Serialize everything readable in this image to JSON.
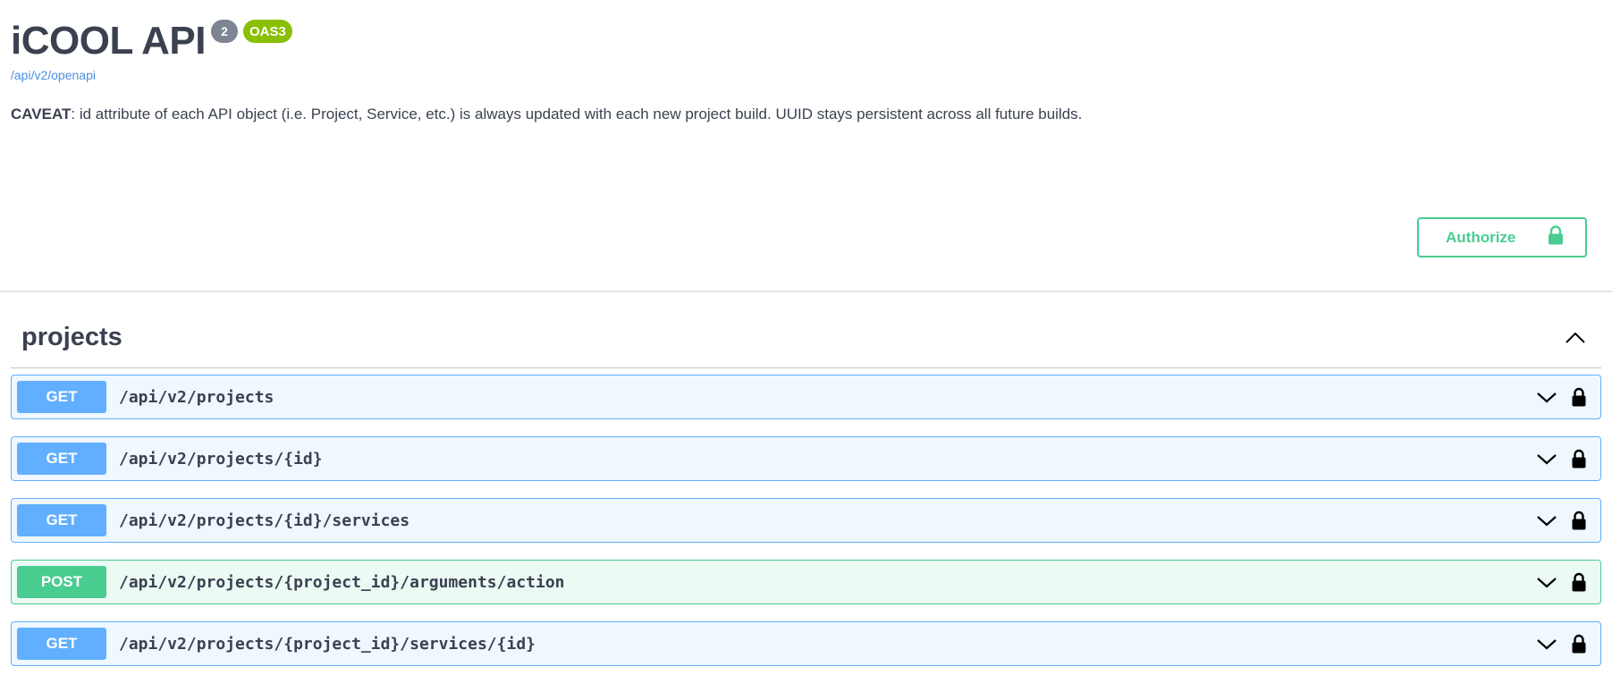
{
  "info": {
    "title": "iCOOL API",
    "version_badge": "2",
    "oas_badge": "OAS3",
    "spec_link": "/api/v2/openapi",
    "caveat_label": "CAVEAT",
    "caveat_text": ": id attribute of each API object (i.e. Project, Service, etc.) is always updated with each new project build. UUID stays persistent across all future builds."
  },
  "authorize": {
    "label": "Authorize",
    "icon": "lock-icon"
  },
  "tag": {
    "name": "projects",
    "expanded": true,
    "operations": [
      {
        "method": "GET",
        "path": "/api/v2/projects"
      },
      {
        "method": "GET",
        "path": "/api/v2/projects/{id}"
      },
      {
        "method": "GET",
        "path": "/api/v2/projects/{id}/services"
      },
      {
        "method": "POST",
        "path": "/api/v2/projects/{project_id}/arguments/action"
      },
      {
        "method": "GET",
        "path": "/api/v2/projects/{project_id}/services/{id}"
      }
    ]
  },
  "colors": {
    "get": "#61affe",
    "post": "#49cc90",
    "oas": "#89bf04",
    "version": "#7d8492",
    "text": "#3b4151"
  }
}
